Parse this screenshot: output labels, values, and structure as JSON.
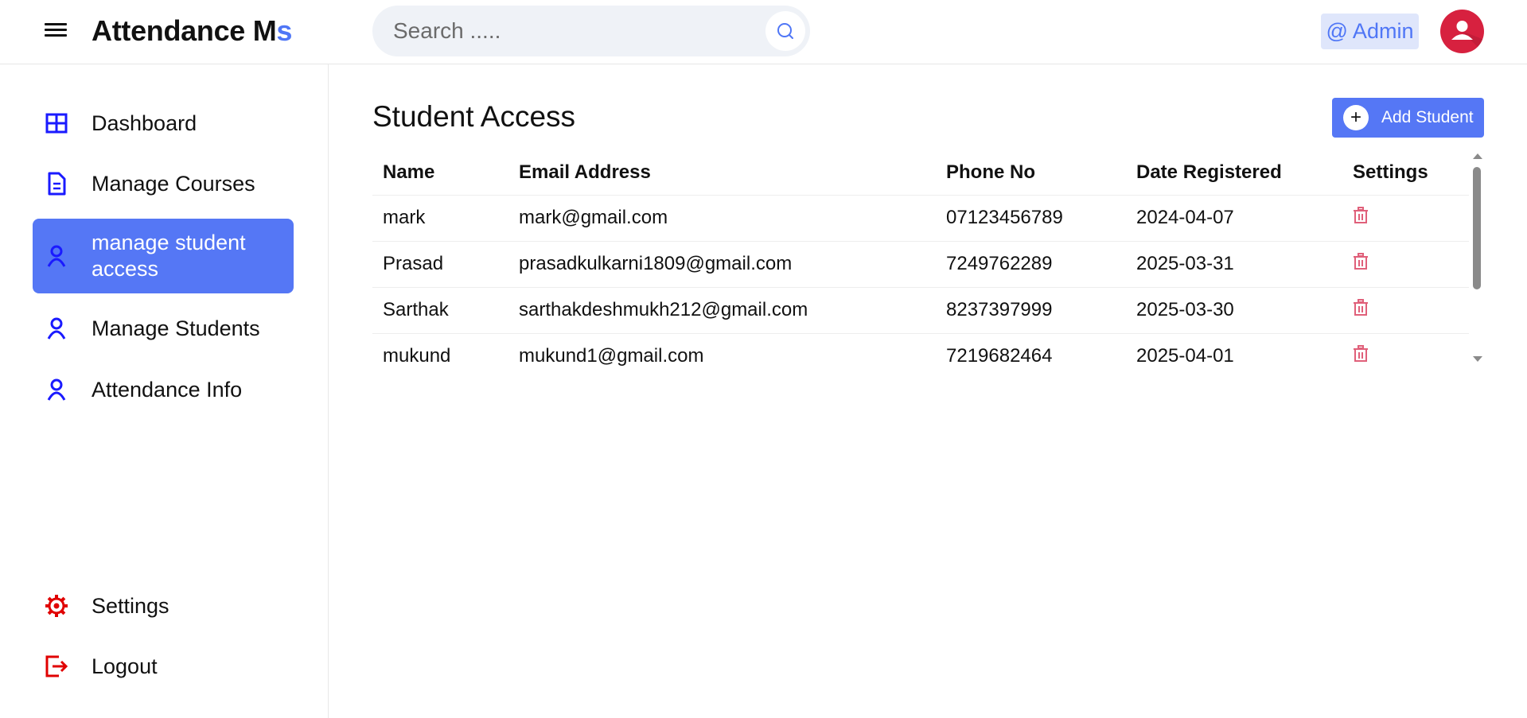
{
  "header": {
    "brand_main": "Attendance M",
    "brand_accent": "s",
    "search_placeholder": "Search .....",
    "admin_label": "@ Admin"
  },
  "sidebar": {
    "items": [
      {
        "label": "Dashboard",
        "icon": "grid-icon"
      },
      {
        "label": "Manage Courses",
        "icon": "document-icon"
      },
      {
        "label": "manage student access",
        "icon": "user-icon",
        "active": true
      },
      {
        "label": "Manage Students",
        "icon": "user-icon"
      },
      {
        "label": "Attendance Info",
        "icon": "user-icon"
      }
    ],
    "bottom_items": [
      {
        "label": "Settings",
        "icon": "gear-icon"
      },
      {
        "label": "Logout",
        "icon": "logout-icon"
      }
    ]
  },
  "main": {
    "title": "Student Access",
    "add_button": "Add Student",
    "table": {
      "headers": [
        "Name",
        "Email Address",
        "Phone No",
        "Date Registered",
        "Settings"
      ],
      "rows": [
        {
          "name": "mark",
          "email": "mark@gmail.com",
          "phone": "07123456789",
          "date": "2024-04-07"
        },
        {
          "name": "Prasad",
          "email": "prasadkulkarni1809@gmail.com",
          "phone": "7249762289",
          "date": "2025-03-31"
        },
        {
          "name": "Sarthak",
          "email": "sarthakdeshmukh212@gmail.com",
          "phone": "8237397999",
          "date": "2025-03-30"
        },
        {
          "name": "mukund",
          "email": "mukund1@gmail.com",
          "phone": "7219682464",
          "date": "2025-04-01"
        }
      ]
    }
  },
  "colors": {
    "accent": "#5577f5",
    "nav_icon": "#1a1aff",
    "danger": "#e00000",
    "trash": "#e0607a",
    "avatar": "#d7213f"
  }
}
